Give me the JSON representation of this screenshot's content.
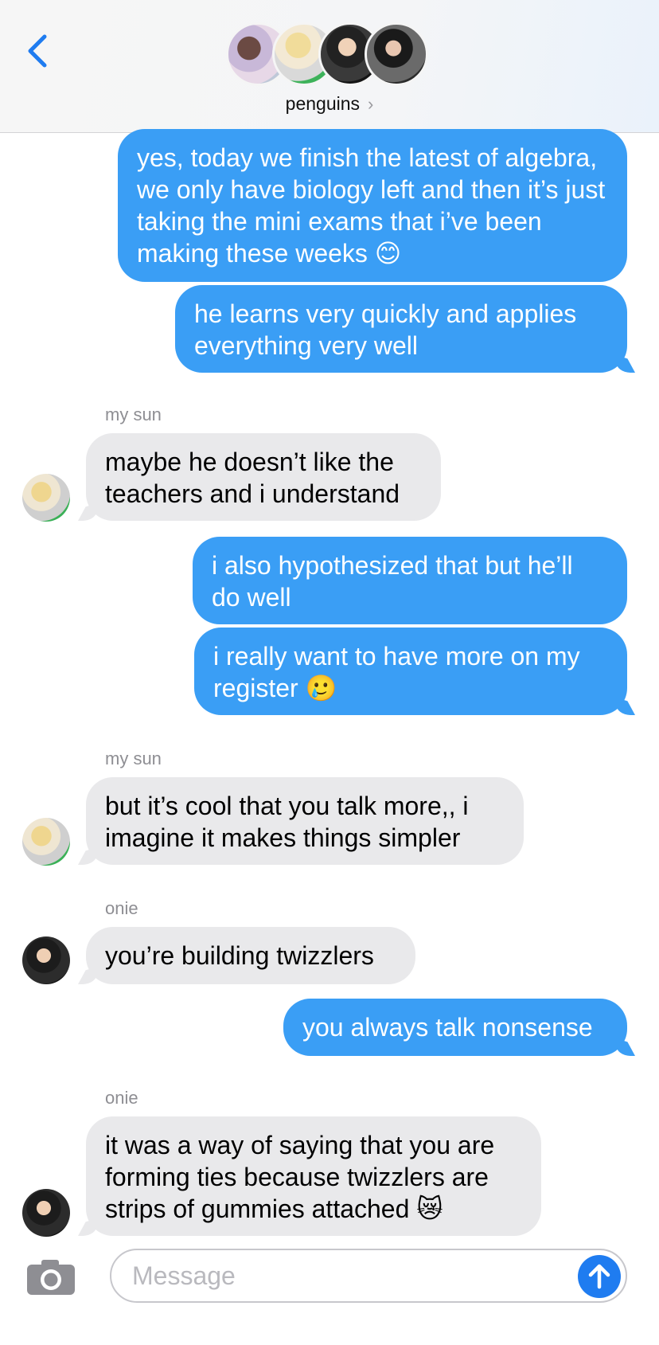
{
  "header": {
    "group_name": "penguins",
    "chevron": "›",
    "back_icon": "chevron-left-icon",
    "accent_color": "#1f7cf0"
  },
  "messages": [
    {
      "direction": "outgoing",
      "text": "yes, today we finish the latest of algebra, we only have biology left and then it’s just taking the mini exams that i’ve been making these weeks 😊"
    },
    {
      "direction": "outgoing",
      "text": "he learns very quickly and applies everything very well"
    },
    {
      "direction": "incoming",
      "sender": "my sun",
      "text": "maybe he doesn’t like the teachers and i understand"
    },
    {
      "direction": "outgoing",
      "text": "i also hypothesized that but he’ll do well"
    },
    {
      "direction": "outgoing",
      "text": "i really want to have more on my register 🥲"
    },
    {
      "direction": "incoming",
      "sender": "my sun",
      "text": "but it’s cool that you talk more,, i imagine it makes things simpler"
    },
    {
      "direction": "incoming",
      "sender": "onie",
      "text": "you’re building twizzlers"
    },
    {
      "direction": "outgoing",
      "text": "you always talk nonsense"
    },
    {
      "direction": "incoming",
      "sender": "onie",
      "text": "it was a way of saying that you are forming ties because twizzlers are strips of gummies attached 😿"
    }
  ],
  "composer": {
    "placeholder": "Message",
    "camera_icon": "camera-icon",
    "send_icon": "arrow-up-icon"
  },
  "colors": {
    "outgoing_bubble": "#3a9ef5",
    "incoming_bubble": "#e9e9eb"
  }
}
